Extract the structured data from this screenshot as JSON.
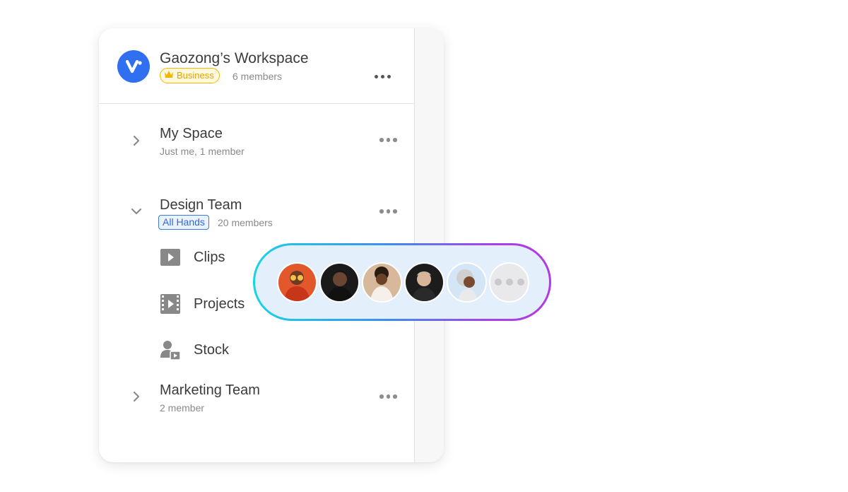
{
  "workspace": {
    "name": "Gaozong’s Workspace",
    "plan_badge": "Business",
    "members": "6 members",
    "logo_icon": "vidio-logo-icon",
    "more_icon": "more-horizontal-icon"
  },
  "groups": [
    {
      "title": "My Space",
      "subtitle": "Just me, 1 member",
      "expanded": false
    },
    {
      "title": "Design Team",
      "badge": "All Hands",
      "subtitle": "20 members",
      "expanded": true,
      "items": [
        {
          "label": "Clips",
          "icon": "play-box-icon"
        },
        {
          "label": "Projects",
          "icon": "film-strip-icon"
        },
        {
          "label": "Stock",
          "icon": "person-video-icon"
        }
      ]
    },
    {
      "title": "Marketing Team",
      "subtitle": "2 member",
      "expanded": false
    }
  ],
  "members_popover": {
    "avatars": [
      "avatar-1",
      "avatar-2",
      "avatar-3",
      "avatar-4",
      "avatar-5"
    ],
    "more_icon": "more-horizontal-icon"
  },
  "colors": {
    "brand_blue": "#2f6ff0",
    "business_gold": "#f2b705",
    "allhands_blue": "#3a7be0",
    "pill_gradient_start": "#19d3e6",
    "pill_gradient_end": "#b23ae0"
  }
}
